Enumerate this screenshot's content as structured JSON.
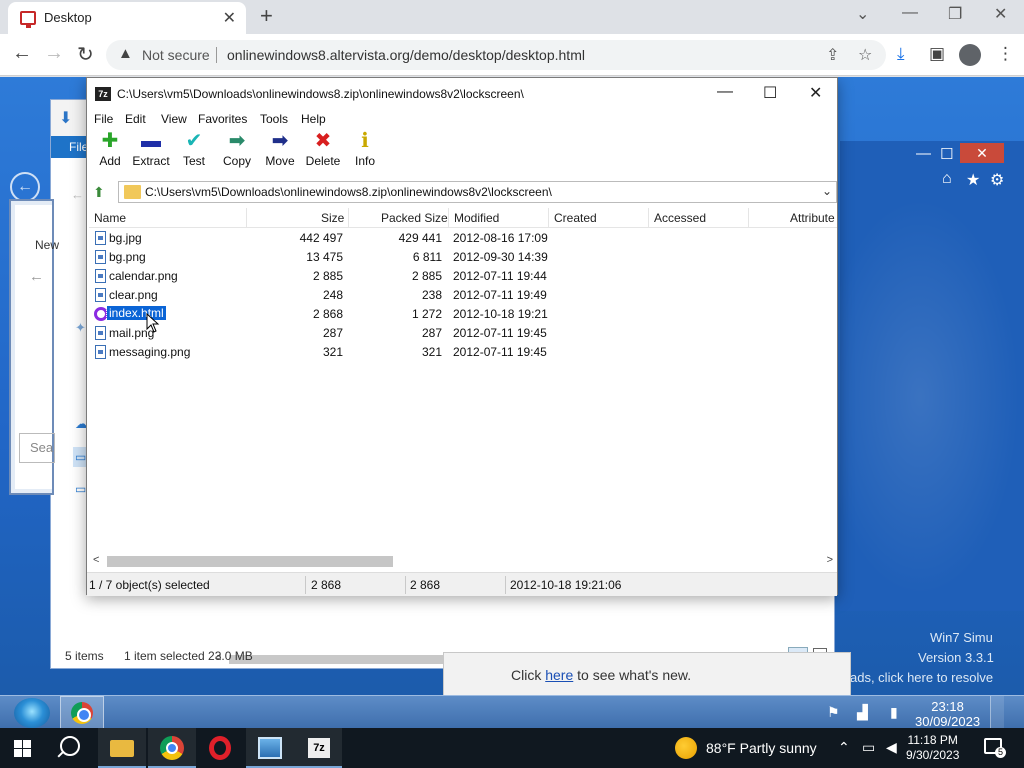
{
  "browser": {
    "tab_title": "Desktop",
    "tab_close": "✕",
    "new_tab": "+",
    "window_controls": [
      "⌄",
      "—",
      "❐",
      "✕"
    ],
    "back": "←",
    "forward": "→",
    "reload": "↻",
    "security_label": "Not secure",
    "url": "onlinewindows8.altervista.org/demo/desktop/desktop.html"
  },
  "win7": {
    "explorer": {
      "ribbon_label": "File",
      "status_items": "5 items",
      "status_selected": "1 item selected  23.0 MB",
      "side_tab": "New",
      "search_placeholder": "Sea"
    },
    "notify": {
      "prefix": "Click ",
      "link": "here",
      "suffix": " to see what's new."
    },
    "sim_version_title": "Win7 Simu",
    "sim_version": "Version 3.3.1",
    "sim_resolve": "ads, click here to resolve",
    "clock_time": "23:18",
    "clock_date": "30/09/2023"
  },
  "sevenzip": {
    "title": "C:\\Users\\vm5\\Downloads\\onlinewindows8.zip\\onlinewindows8v2\\lockscreen\\",
    "logo": "7z",
    "menu": [
      "File",
      "Edit",
      "View",
      "Favorites",
      "Tools",
      "Help"
    ],
    "tools": [
      {
        "label": "Add",
        "glyph": "✚",
        "color": "#2aa52a"
      },
      {
        "label": "Extract",
        "glyph": "▬",
        "color": "#1f2fa8"
      },
      {
        "label": "Test",
        "glyph": "✔",
        "color": "#1ab5b5"
      },
      {
        "label": "Copy",
        "glyph": "➡",
        "color": "#2a8a6a"
      },
      {
        "label": "Move",
        "glyph": "➡",
        "color": "#1f2f8a"
      },
      {
        "label": "Delete",
        "glyph": "✖",
        "color": "#d81f1f"
      },
      {
        "label": "Info",
        "glyph": "ℹ",
        "color": "#c9a800"
      }
    ],
    "address": "C:\\Users\\vm5\\Downloads\\onlinewindows8.zip\\onlinewindows8v2\\lockscreen\\",
    "columns": [
      "Name",
      "Size",
      "Packed Size",
      "Modified",
      "Created",
      "Accessed",
      "Attribute"
    ],
    "files": [
      {
        "name": "bg.jpg",
        "size": "442 497",
        "packed": "429 441",
        "modified": "2012-08-16 17:09"
      },
      {
        "name": "bg.png",
        "size": "13 475",
        "packed": "6 811",
        "modified": "2012-09-30 14:39"
      },
      {
        "name": "calendar.png",
        "size": "2 885",
        "packed": "2 885",
        "modified": "2012-07-11 19:44"
      },
      {
        "name": "clear.png",
        "size": "248",
        "packed": "238",
        "modified": "2012-07-11 19:49"
      },
      {
        "name": "index.html",
        "size": "2 868",
        "packed": "1 272",
        "modified": "2012-10-18 19:21",
        "selected": true
      },
      {
        "name": "mail.png",
        "size": "287",
        "packed": "287",
        "modified": "2012-07-11 19:45"
      },
      {
        "name": "messaging.png",
        "size": "321",
        "packed": "321",
        "modified": "2012-07-11 19:45"
      }
    ],
    "status": {
      "selection": "1 / 7 object(s) selected",
      "size": "2 868",
      "packed": "2 868",
      "modified": "2012-10-18 19:21:06"
    }
  },
  "taskbar": {
    "weather_temp": "88°F",
    "weather_desc": "Partly sunny",
    "time": "11:18 PM",
    "date": "9/30/2023",
    "notification_count": "5",
    "sevenzip_label": "7z"
  }
}
